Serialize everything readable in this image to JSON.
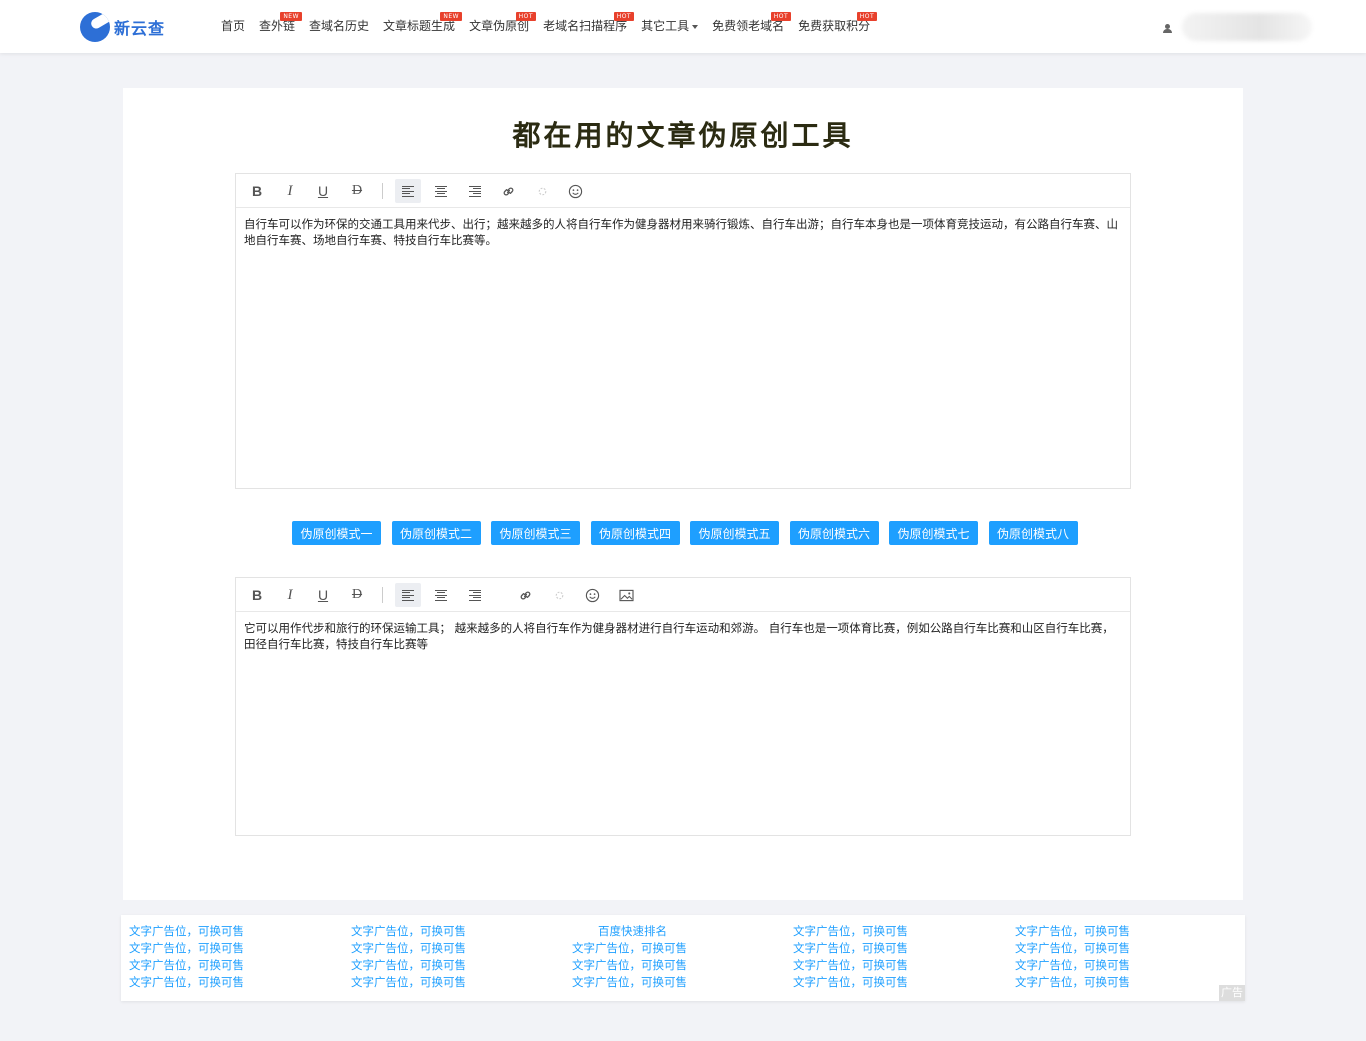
{
  "header": {
    "logo_text": "新云查",
    "nav": [
      {
        "label": "首页",
        "badge": ""
      },
      {
        "label": "查外链",
        "badge": "NEW"
      },
      {
        "label": "查域名历史",
        "badge": ""
      },
      {
        "label": "文章标题生成",
        "badge": "NEW"
      },
      {
        "label": "文章伪原创",
        "badge": "HOT"
      },
      {
        "label": "老域名扫描程序",
        "badge": "HOT"
      },
      {
        "label": "其它工具",
        "badge": ""
      },
      {
        "label": "免费领老域名",
        "badge": "HOT"
      },
      {
        "label": "免费获取积分",
        "badge": "HOT"
      }
    ]
  },
  "page": {
    "title": "都在用的文章伪原创工具"
  },
  "editor_input": {
    "text": "自行车可以作为环保的交通工具用来代步、出行；越来越多的人将自行车作为健身器材用来骑行锻炼、自行车出游；自行车本身也是一项体育竞技运动，有公路自行车赛、山地自行车赛、场地自行车赛、特技自行车比赛等。"
  },
  "modes": [
    "伪原创模式一",
    "伪原创模式二",
    "伪原创模式三",
    "伪原创模式四",
    "伪原创模式五",
    "伪原创模式六",
    "伪原创模式七",
    "伪原创模式八"
  ],
  "editor_output": {
    "text": "它可以用作代步和旅行的环保运输工具； 越来越多的人将自行车作为健身器材进行自行车运动和郊游。 自行车也是一项体育比赛，例如公路自行车比赛和山区自行车比赛，田径自行车比赛，特技自行车比赛等"
  },
  "ads": {
    "columns": [
      [
        "文字广告位，可换可售",
        "文字广告位，可换可售",
        "文字广告位，可换可售",
        "文字广告位，可换可售"
      ],
      [
        "文字广告位，可换可售",
        "文字广告位，可换可售",
        "文字广告位，可换可售",
        "文字广告位，可换可售"
      ],
      [
        "百度快速排名",
        "文字广告位，可换可售",
        "文字广告位，可换可售",
        "文字广告位，可换可售"
      ],
      [
        "文字广告位，可换可售",
        "文字广告位，可换可售",
        "文字广告位，可换可售",
        "文字广告位，可换可售"
      ],
      [
        "文字广告位，可换可售",
        "文字广告位，可换可售",
        "文字广告位，可换可售",
        "文字广告位，可换可售"
      ]
    ],
    "tag": "广告"
  },
  "colors": {
    "accent": "#1e9fff",
    "brand": "#2d6fd6",
    "badge": "#e8412c"
  }
}
